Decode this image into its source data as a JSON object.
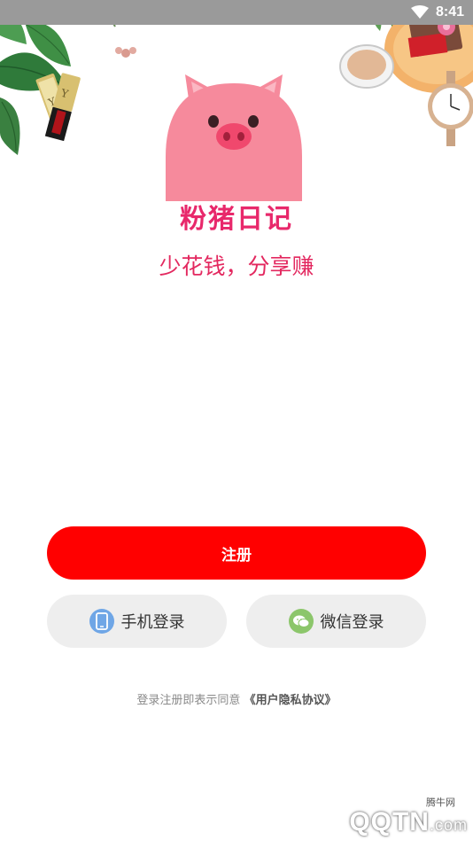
{
  "status_bar": {
    "time": "8:41"
  },
  "app": {
    "name": "粉猪日记",
    "slogan": "少花钱，分享赚"
  },
  "buttons": {
    "register_label": "注册",
    "phone_login_label": "手机登录",
    "wechat_login_label": "微信登录"
  },
  "agreement": {
    "text": "登录注册即表示同意",
    "link": "《用户隐私协议》"
  },
  "watermark": {
    "small": "腾牛网",
    "main": "QQTN",
    "suffix": ".com"
  },
  "icons": {
    "wifi": "wifi-icon",
    "phone": "phone-icon",
    "wechat": "wechat-icon",
    "pig": "pig-logo-icon"
  },
  "colors": {
    "primary": "#ff0000",
    "brand_pink": "#e8286b",
    "pig_body": "#f68a9c",
    "secondary_button": "#eeeeee",
    "phone_icon_bg": "#6fa6e6",
    "wechat_icon_bg": "#8cc66b"
  }
}
